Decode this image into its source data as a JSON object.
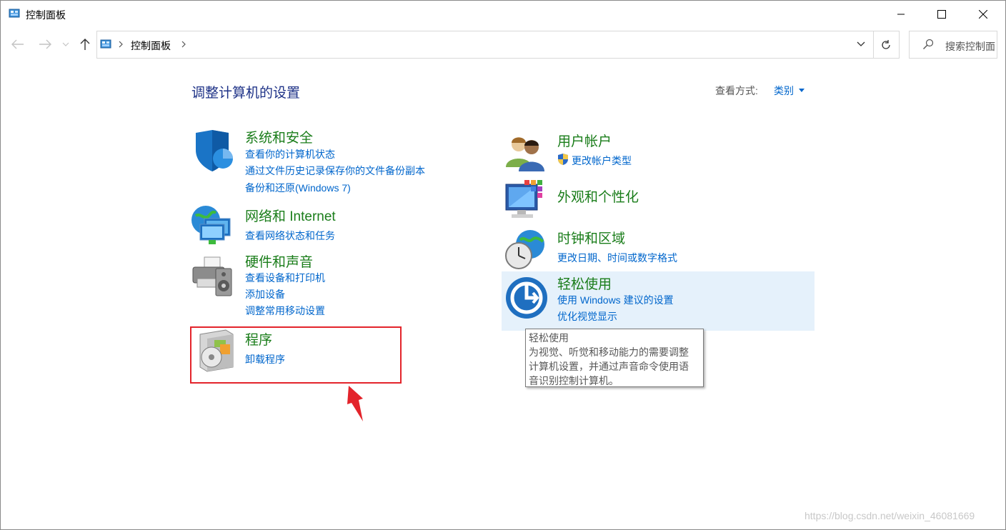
{
  "window": {
    "title": "控制面板",
    "icons": [
      "control-panel-icon",
      "minimize-icon",
      "maximize-icon",
      "close-icon"
    ]
  },
  "address": {
    "breadcrumb": "控制面板",
    "search_placeholder": "搜索控制面板",
    "icons": [
      "back-arrow-icon",
      "forward-arrow-icon",
      "recent-dropdown-icon",
      "up-arrow-icon",
      "refresh-icon",
      "search-icon"
    ]
  },
  "main": {
    "heading": "调整计算机的设置",
    "view_by_label": "查看方式:",
    "view_by_value": "类别"
  },
  "categories": {
    "system": {
      "title": "系统和安全",
      "links": [
        "查看你的计算机状态",
        "通过文件历史记录保存你的文件备份副本",
        "备份和还原(Windows 7)"
      ]
    },
    "network": {
      "title": "网络和 Internet",
      "links": [
        "查看网络状态和任务"
      ]
    },
    "hardware": {
      "title": "硬件和声音",
      "links": [
        "查看设备和打印机",
        "添加设备",
        "调整常用移动设置"
      ]
    },
    "programs": {
      "title": "程序",
      "links": [
        "卸载程序"
      ]
    },
    "accounts": {
      "title": "用户帐户",
      "links": [
        "更改帐户类型"
      ]
    },
    "appearance": {
      "title": "外观和个性化",
      "links": []
    },
    "clock": {
      "title": "时钟和区域",
      "links": [
        "更改日期、时间或数字格式"
      ]
    },
    "ease": {
      "title": "轻松使用",
      "links": [
        "使用 Windows 建议的设置",
        "优化视觉显示"
      ]
    }
  },
  "tooltip": {
    "lines": [
      "轻松使用",
      "为视觉、听觉和移动能力的需要调整",
      "计算机设置，并通过声音命令使用语",
      "音识别控制计算机。"
    ]
  },
  "annotation": {
    "color": "#e3242b"
  },
  "watermark": "https://blog.csdn.net/weixin_46081669",
  "colors": {
    "heading": "#1e3287",
    "category": "#1a7d1a",
    "link": "#0066cc",
    "hover": "#e5f1fb"
  }
}
